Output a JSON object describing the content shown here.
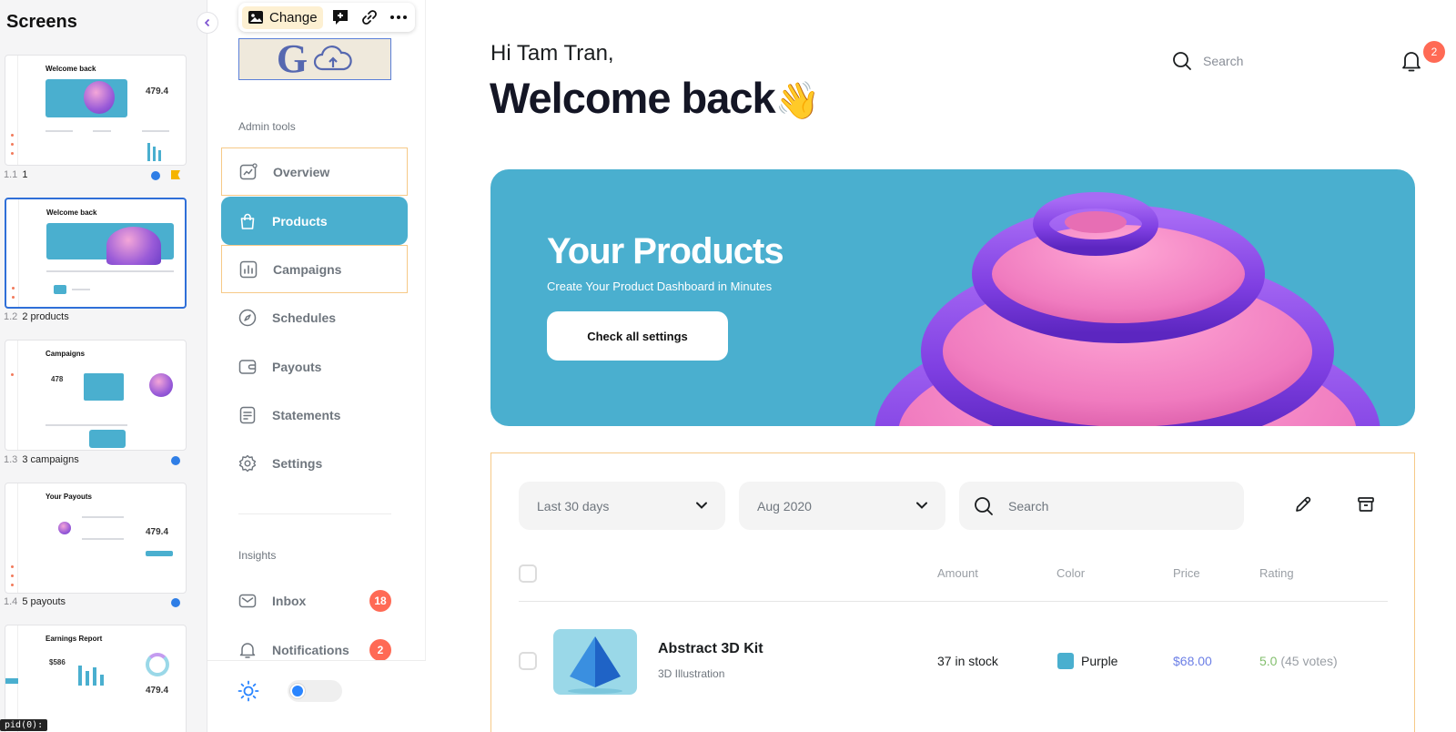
{
  "screens_panel": {
    "title": "Screens",
    "items": [
      {
        "num": "1.1",
        "label": "1",
        "thumb_title": "Welcome back"
      },
      {
        "num": "1.2",
        "label": "2 products",
        "thumb_title": "Welcome back"
      },
      {
        "num": "1.3",
        "label": "3 campaigns",
        "thumb_title": "Campaigns",
        "thumb_value": "478"
      },
      {
        "num": "1.4",
        "label": "5 payouts",
        "thumb_title": "Your Payouts",
        "thumb_value": "479.4"
      },
      {
        "num": "",
        "label": "",
        "thumb_title": "Earnings Report",
        "thumb_value": "$586"
      }
    ],
    "thumb1_value": "479.4",
    "thumb5_value2": "479.4",
    "tooltip": "pid(0):"
  },
  "toolbar": {
    "change_label": "Change"
  },
  "sidebar": {
    "admin_label": "Admin tools",
    "nav": [
      {
        "label": "Overview"
      },
      {
        "label": "Products"
      },
      {
        "label": "Campaigns"
      },
      {
        "label": "Schedules"
      },
      {
        "label": "Payouts"
      },
      {
        "label": "Statements"
      },
      {
        "label": "Settings"
      }
    ],
    "insights_label": "Insights",
    "insights": [
      {
        "label": "Inbox",
        "badge": "18"
      },
      {
        "label": "Notifications",
        "badge": "2"
      }
    ]
  },
  "header": {
    "greeting": "Hi Tam Tran,",
    "welcome": "Welcome back",
    "welcome_emoji": "👋",
    "search_placeholder": "Search",
    "notification_count": "2"
  },
  "hero": {
    "title": "Your Products",
    "subtitle": "Create Your Product Dashboard in Minutes",
    "button": "Check all settings"
  },
  "filters": {
    "period": "Last 30 days",
    "month": "Aug 2020",
    "search_placeholder": "Search"
  },
  "table": {
    "columns": [
      "Amount",
      "Color",
      "Price",
      "Rating"
    ],
    "rows": [
      {
        "name": "Abstract 3D Kit",
        "category": "3D Illustration",
        "amount": "37 in stock",
        "color": "Purple",
        "color_hex": "#4aafcf",
        "price": "$68.00",
        "rating": "5.0",
        "votes": "(45 votes)"
      }
    ]
  },
  "colors": {
    "accent": "#4aafcf",
    "badge": "#ff6a55",
    "highlight_outline": "#f6c987"
  }
}
